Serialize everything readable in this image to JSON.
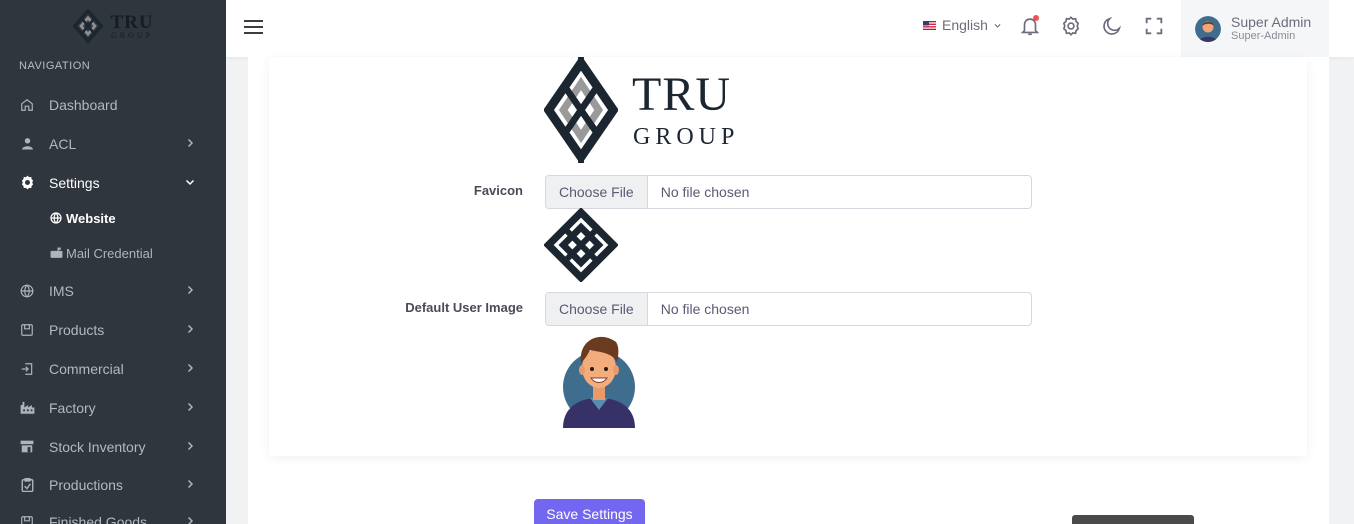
{
  "brand": {
    "word": "TRU",
    "sub": "GROUP"
  },
  "sidebar": {
    "heading": "NAVIGATION",
    "items": [
      {
        "label": "Dashboard",
        "icon": "home-icon"
      },
      {
        "label": "ACL",
        "icon": "user-icon"
      },
      {
        "label": "Settings",
        "icon": "gear-icon"
      },
      {
        "label": "IMS",
        "icon": "globe-icon"
      },
      {
        "label": "Products",
        "icon": "box-icon"
      },
      {
        "label": "Commercial",
        "icon": "login-icon"
      },
      {
        "label": "Factory",
        "icon": "factory-icon"
      },
      {
        "label": "Stock Inventory",
        "icon": "store-icon"
      },
      {
        "label": "Productions",
        "icon": "clipboard-icon"
      },
      {
        "label": "Finished Goods",
        "icon": "box-icon"
      }
    ],
    "settings_sub": [
      {
        "label": "Website",
        "icon": "globe-icon"
      },
      {
        "label": "Mail Credential",
        "icon": "mailbox-icon"
      }
    ]
  },
  "topbar": {
    "language": "English",
    "user_name": "Super Admin",
    "user_role": "Super-Admin"
  },
  "form": {
    "logo": {
      "word": "TRU",
      "sub": "GROUP"
    },
    "favicon_label": "Favicon",
    "default_user_image_label": "Default User Image",
    "choose_file": "Choose File",
    "no_file": "No file chosen",
    "save_label": "Save Settings"
  },
  "colors": {
    "sidebar_bg": "#30363d",
    "accent": "#7367f0",
    "notification": "#ea5455",
    "logo_dark": "#1b2631",
    "logo_gray": "#9a9a9a"
  }
}
